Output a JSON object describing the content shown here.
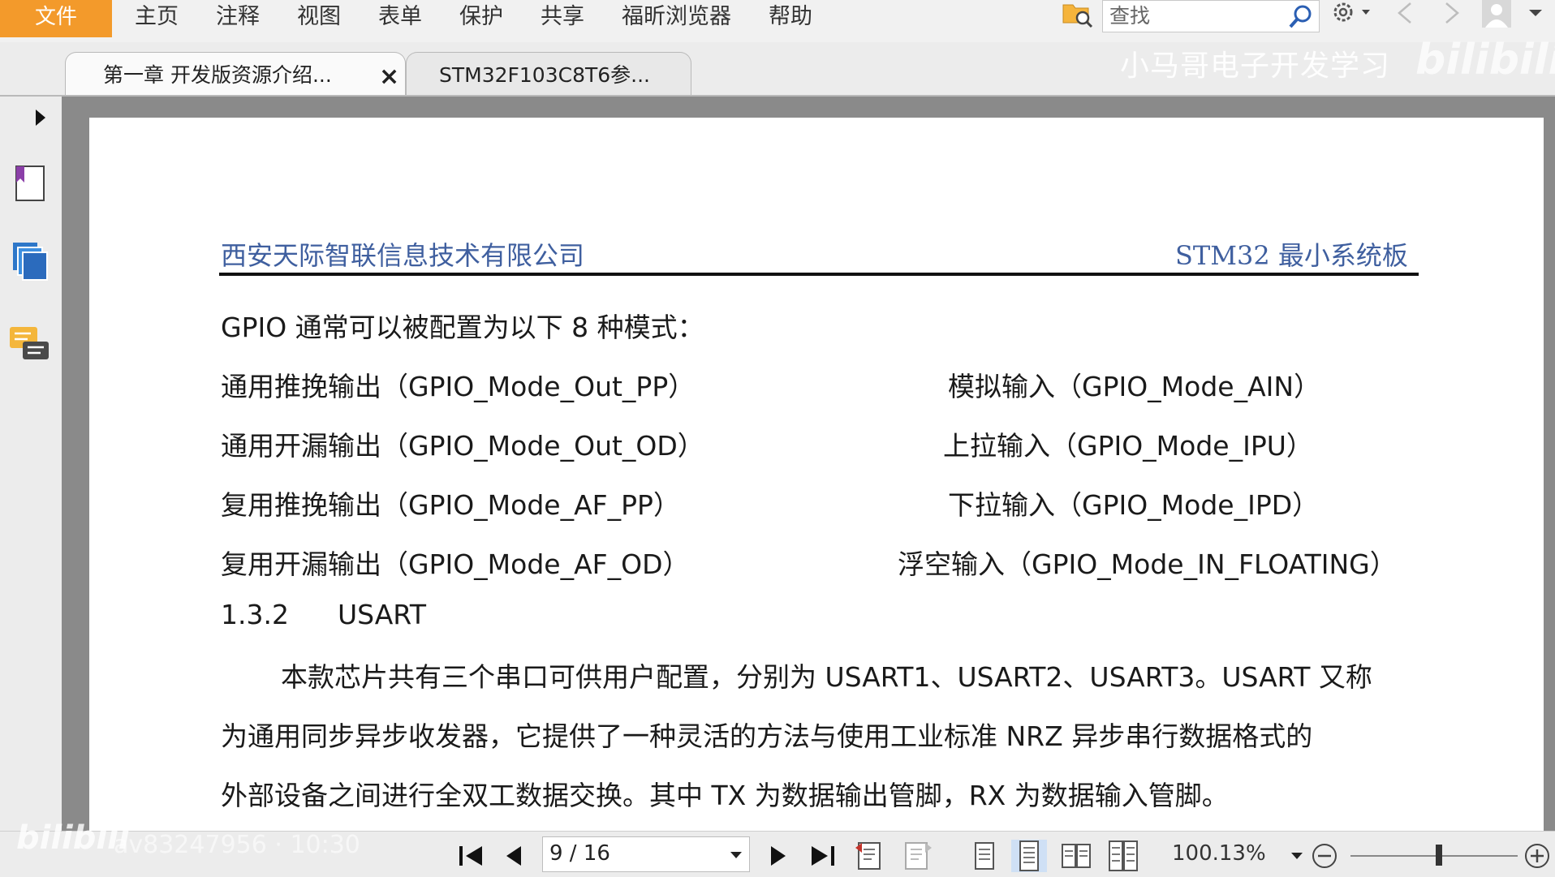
{
  "menubar": {
    "file_label": "文件",
    "items": [
      "主页",
      "注释",
      "视图",
      "表单",
      "保护",
      "共享",
      "福昕浏览器",
      "帮助"
    ]
  },
  "search": {
    "placeholder": "查找"
  },
  "tabs": [
    {
      "label": "第一章 开发版资源介绍...",
      "close": "×"
    },
    {
      "label": "STM32F103C8T6参..."
    }
  ],
  "watermark": {
    "text": "小马哥电子开发学习",
    "logo": "bilibili",
    "bottom_logo": "bilibili",
    "bottom_id": "av83247956 · 10:30"
  },
  "document": {
    "header_left": "西安天际智联信息技术有限公司",
    "header_right": "STM32 最小系统板",
    "intro": "GPIO 通常可以被配置为以下 8 种模式：",
    "modes_left": [
      "通用推挽输出（GPIO_Mode_Out_PP）",
      "通用开漏输出（GPIO_Mode_Out_OD）",
      "复用推挽输出（GPIO_Mode_AF_PP）",
      "复用开漏输出（GPIO_Mode_AF_OD）"
    ],
    "modes_right": [
      "模拟输入（GPIO_Mode_AIN）",
      "上拉输入（GPIO_Mode_IPU）",
      "下拉输入（GPIO_Mode_IPD）",
      "浮空输入（GPIO_Mode_IN_FLOATING）"
    ],
    "section_number": "1.3.2",
    "section_title": "USART",
    "paragraph": [
      "本款芯片共有三个串口可供用户配置，分别为 USART1、USART2、USART3。USART 又称",
      "为通用同步异步收发器，它提供了一种灵活的方法与使用工业标准 NRZ 异步串行数据格式的",
      "外部设备之间进行全双工数据交换。其中 TX 为数据输出管脚，RX 为数据输入管脚。"
    ]
  },
  "statusbar": {
    "page_value": "9 / 16",
    "zoom": "100.13%",
    "zoom_level_fraction": 0.53
  },
  "colors": {
    "accent": "#f39a2b",
    "header_text": "#3f5f9f",
    "doc_bg": "#8a8a8a"
  }
}
